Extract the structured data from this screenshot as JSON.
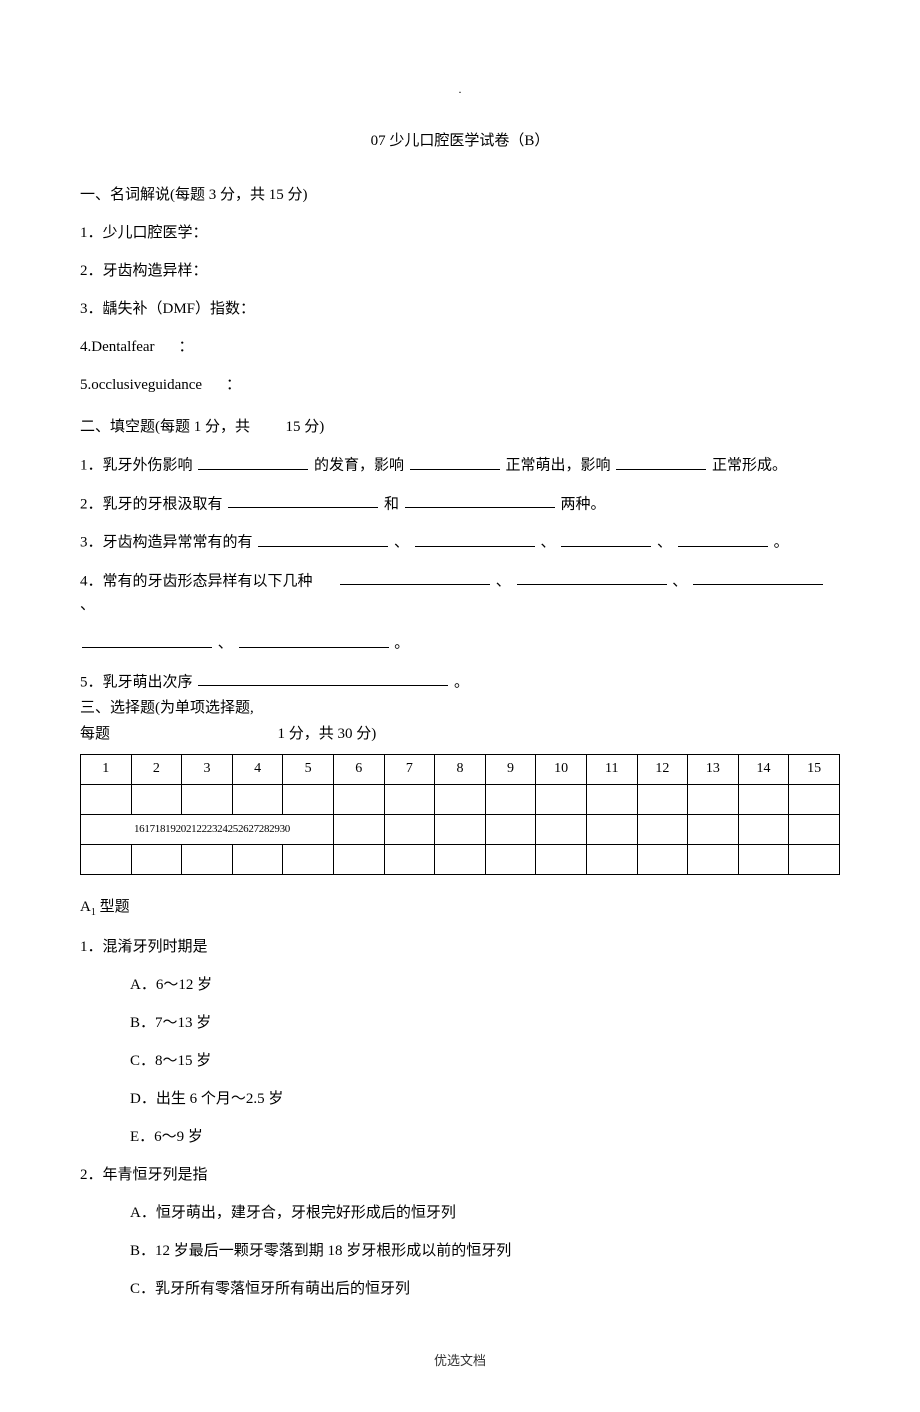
{
  "dot": ".",
  "title": "07 少儿口腔医学试卷（B）",
  "section1": {
    "heading": "一、名词解说(每题 3 分，共 15 分)",
    "items": {
      "i1": "1．少儿口腔医学：",
      "i2": "2．牙齿构造异样：",
      "i3": "3．龋失补（DMF）指数：",
      "i4_a": "4.Dentalfear",
      "i4_b": "：",
      "i5_a": "5.occlusiveguidance",
      "i5_b": "："
    }
  },
  "section2": {
    "heading_a": "二、填空题(每题 1 分，共",
    "heading_b": "15 分)",
    "q1": {
      "a": "1．乳牙外伤影响",
      "b": "的发育，影响",
      "c": "正常萌出，影响",
      "d": "正常形成。"
    },
    "q2": {
      "a": "2．乳牙的牙根汲取有",
      "b": "和",
      "c": "两种。"
    },
    "q3": {
      "a": "3．牙齿构造异常常有的有",
      "b": "、",
      "c": "、",
      "d": "、",
      "e": "。"
    },
    "q4": {
      "a": "4．常有的牙齿形态异样有以下几种",
      "b": "、",
      "c": "、",
      "d": "、",
      "e": "、",
      "f": "、",
      "g": "。"
    },
    "q5": {
      "a": "5．乳牙萌出次序",
      "b": "。"
    }
  },
  "section3": {
    "line1": "三、选择题(为单项选择题,",
    "line2_a": "每题",
    "line2_b": "1 分，共 30 分)",
    "headers": [
      "1",
      "2",
      "3",
      "4",
      "5",
      "6",
      "7",
      "8",
      "9",
      "10",
      "11",
      "12",
      "13",
      "14",
      "15"
    ],
    "row2_text": "161718192021222324252627282930"
  },
  "a1_label_a": "A",
  "a1_label_b": "1",
  "a1_label_c": " 型题",
  "q_mc1": {
    "stem": "1．混淆牙列时期是",
    "A": "A．6～12 岁",
    "B": "B．7～13 岁",
    "C": "C．8～15 岁",
    "D": "D．出生 6 个月～2.5 岁",
    "E": "E．6～9 岁"
  },
  "q_mc2": {
    "stem": "2．年青恒牙列是指",
    "A": "A．恒牙萌出，建牙合，牙根完好形成后的恒牙列",
    "B": "B．12 岁最后一颗牙零落到期 18 岁牙根形成以前的恒牙列",
    "C": "C．乳牙所有零落恒牙所有萌出后的恒牙列"
  },
  "footer": "优选文档"
}
